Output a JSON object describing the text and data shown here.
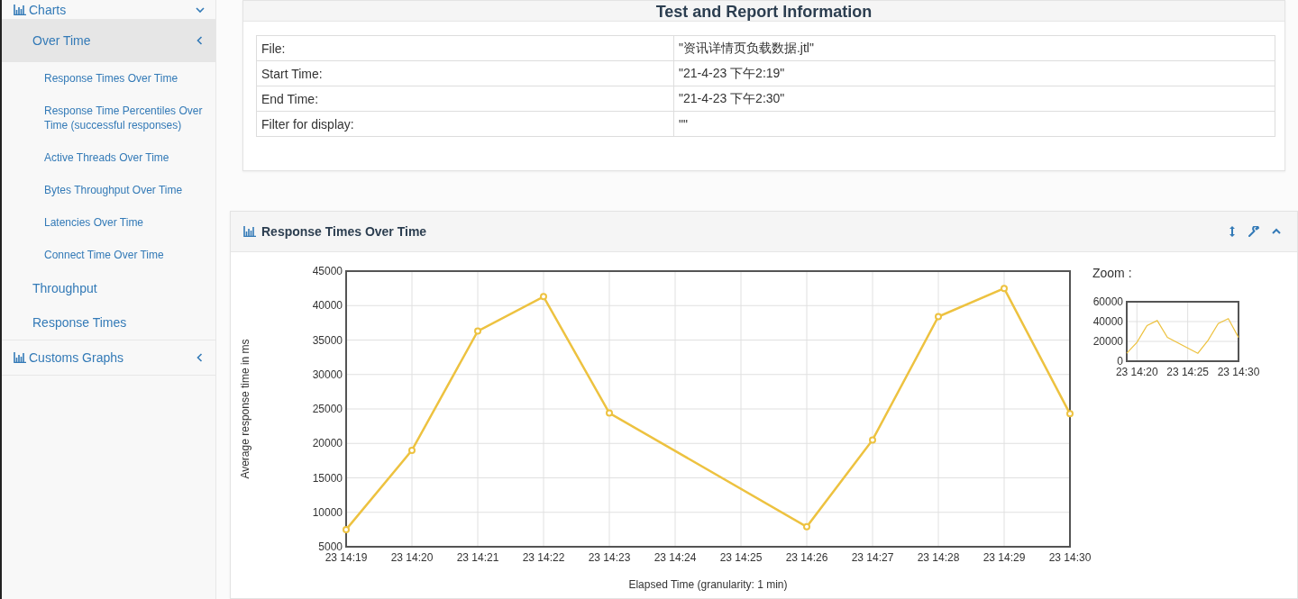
{
  "sidebar": {
    "items": [
      {
        "label": "Charts",
        "selected": false,
        "expanded": true,
        "children": [
          {
            "label": "Over Time",
            "selected": true,
            "expanded": true,
            "children": [
              {
                "label": "Response Times Over Time",
                "selected": false
              },
              {
                "label": "Response Time Percentiles Over Time (successful responses)",
                "selected": false
              },
              {
                "label": "Active Threads Over Time",
                "selected": false
              },
              {
                "label": "Bytes Throughput Over Time",
                "selected": false
              },
              {
                "label": "Latencies Over Time",
                "selected": false
              },
              {
                "label": "Connect Time Over Time",
                "selected": false
              }
            ]
          },
          {
            "label": "Throughput",
            "selected": false
          },
          {
            "label": "Response Times",
            "selected": false
          }
        ]
      },
      {
        "label": "Customs Graphs",
        "selected": false,
        "expanded": false
      }
    ]
  },
  "info_panel": {
    "title": "Test and Report Information",
    "rows": [
      {
        "label": "File:",
        "value": "\"资讯详情页负载数据.jtl\""
      },
      {
        "label": "Start Time:",
        "value": "\"21-4-23 下午2:19\""
      },
      {
        "label": "End Time:",
        "value": "\"21-4-23 下午2:30\""
      },
      {
        "label": "Filter for display:",
        "value": "\"\""
      }
    ]
  },
  "chart_panel": {
    "title": "Response Times Over Time",
    "chart_data": {
      "type": "line",
      "xlabel": "Elapsed Time (granularity: 1 min)",
      "ylabel": "Average response time in ms",
      "categories": [
        "23 14:19",
        "23 14:20",
        "23 14:21",
        "23 14:22",
        "23 14:23",
        "23 14:24",
        "23 14:25",
        "23 14:26",
        "23 14:27",
        "23 14:28",
        "23 14:29",
        "23 14:30"
      ],
      "series": [
        {
          "color": "#edc240",
          "marker": "circle",
          "values": [
            7500,
            19000,
            36300,
            41300,
            24400,
            null,
            null,
            7900,
            20500,
            38400,
            42500,
            24300
          ]
        }
      ],
      "ylim": [
        5000,
        45000
      ],
      "grid": true,
      "yticks": [
        5000,
        10000,
        15000,
        20000,
        25000,
        30000,
        35000,
        40000,
        45000
      ]
    },
    "zoom": {
      "label": "Zoom :",
      "chart_data": {
        "type": "line",
        "categories": [
          null,
          "23 14:20",
          null,
          null,
          null,
          null,
          "23 14:25",
          null,
          null,
          null,
          null,
          "23 14:30"
        ],
        "series": [
          {
            "color": "#edc240",
            "values": [
              8000,
              19000,
              36000,
              41000,
              24000,
              null,
              null,
              8000,
              21000,
              38000,
              43000,
              24000
            ]
          }
        ],
        "ylim": [
          0,
          60000
        ],
        "grid": true,
        "yticks": [
          0,
          20000,
          40000,
          60000
        ]
      }
    }
  }
}
